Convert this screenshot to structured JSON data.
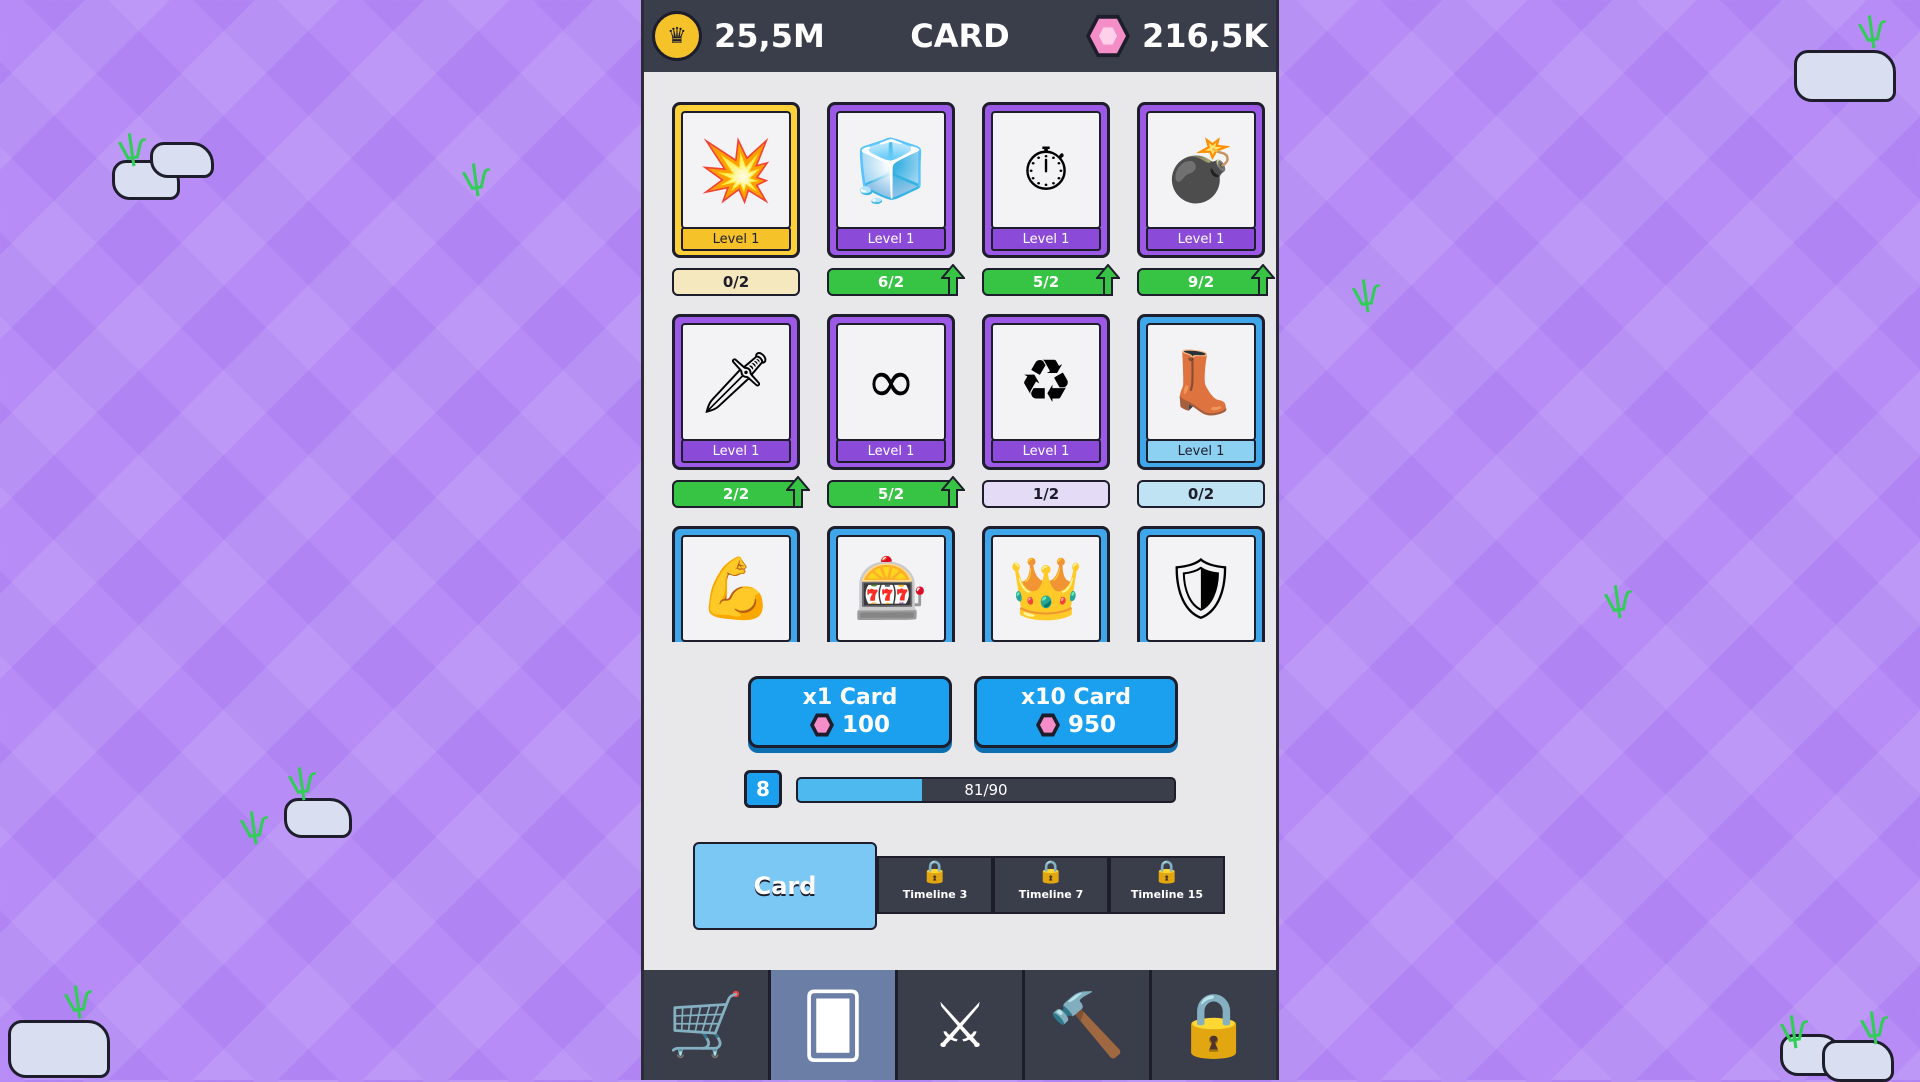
{
  "header": {
    "coins": "25,5M",
    "title": "CARD",
    "gems": "216,5K"
  },
  "cards": [
    {
      "art": "💥",
      "level": "Level 1",
      "rarity": "gold",
      "progress": "0/2",
      "upgradable": false
    },
    {
      "art": "🧊",
      "level": "Level 1",
      "rarity": "purple",
      "progress": "6/2",
      "upgradable": true
    },
    {
      "art": "⏱",
      "level": "Level 1",
      "rarity": "purple",
      "progress": "5/2",
      "upgradable": true
    },
    {
      "art": "💣",
      "level": "Level 1",
      "rarity": "purple",
      "progress": "9/2",
      "upgradable": true
    },
    {
      "art": "🗡",
      "level": "Level 1",
      "rarity": "purple",
      "progress": "2/2",
      "upgradable": true
    },
    {
      "art": "∞",
      "level": "Level 1",
      "rarity": "purple",
      "progress": "5/2",
      "upgradable": true
    },
    {
      "art": "♻",
      "level": "Level 1",
      "rarity": "purple",
      "progress": "1/2",
      "upgradable": false
    },
    {
      "art": "👢",
      "level": "Level 1",
      "rarity": "blue",
      "progress": "0/2",
      "upgradable": false
    },
    {
      "art": "💪",
      "rarity": "blue"
    },
    {
      "art": "🎰",
      "rarity": "blue"
    },
    {
      "art": "👑",
      "rarity": "blue"
    },
    {
      "art": "🛡",
      "rarity": "blue"
    }
  ],
  "buy": {
    "x1_label": "x1 Card",
    "x1_price": "100",
    "x10_label": "x10 Card",
    "x10_price": "950"
  },
  "xp": {
    "level": "8",
    "text": "81/90",
    "fraction": 0.33
  },
  "tabs": {
    "main": "Card",
    "locked": [
      "Timeline 3",
      "Timeline 7",
      "Timeline 15"
    ]
  },
  "nav": [
    {
      "icon": "cart-icon",
      "glyph": "🛒"
    },
    {
      "icon": "cards-icon",
      "glyph": "🂠"
    },
    {
      "icon": "swords-icon",
      "glyph": "⚔"
    },
    {
      "icon": "hammer-icon",
      "glyph": "🔨"
    },
    {
      "icon": "lock-icon",
      "glyph": "🔒"
    }
  ],
  "colors": {
    "primary": "#1ba0f0",
    "topbar": "#3a3d4a",
    "green": "#37c444",
    "purple": "#9b59e6",
    "gold": "#fbd03a"
  }
}
